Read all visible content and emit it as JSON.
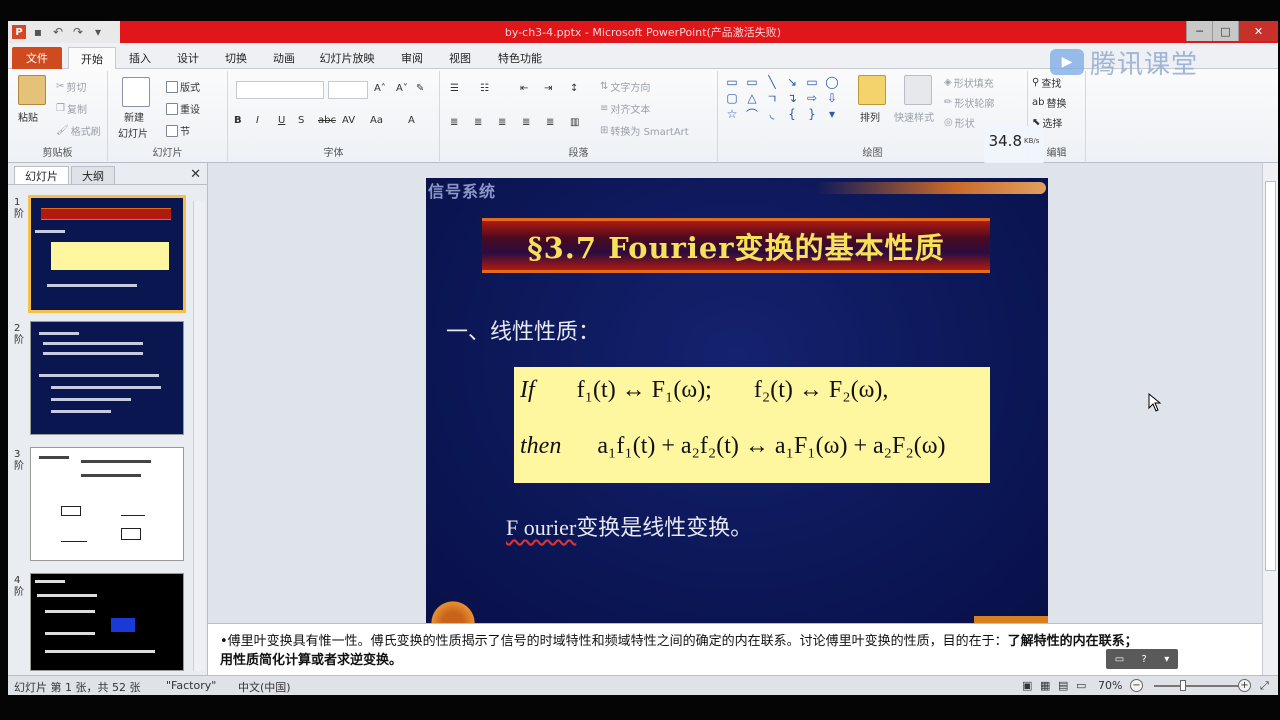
{
  "window": {
    "title": "by-ch3-4.pptx - Microsoft PowerPoint(产品激活失败)"
  },
  "ribbon_tabs": [
    {
      "label": "文件"
    },
    {
      "label": "开始"
    },
    {
      "label": "插入"
    },
    {
      "label": "设计"
    },
    {
      "label": "切换"
    },
    {
      "label": "动画"
    },
    {
      "label": "幻灯片放映"
    },
    {
      "label": "审阅"
    },
    {
      "label": "视图"
    },
    {
      "label": "特色功能"
    }
  ],
  "ribbon": {
    "clipboard": {
      "paste": "粘贴",
      "cut": "剪切",
      "copy": "复制",
      "format_painter": "格式刷",
      "label": "剪贴板"
    },
    "slides": {
      "new_slide": "新建",
      "new_slide2": "幻灯片",
      "layout": "版式",
      "reset": "重设",
      "section": "节",
      "label": "幻灯片"
    },
    "font": {
      "label": "字体"
    },
    "paragraph": {
      "text_direction": "文字方向",
      "align_text": "对齐文本",
      "smartart": "转换为 SmartArt",
      "label": "段落"
    },
    "drawing": {
      "arrange": "排列",
      "quick_styles": "快速样式",
      "shape_fill": "形状填充",
      "shape_outline": "形状轮廓",
      "shape_effects": "形状",
      "label": "绘图"
    },
    "editing": {
      "find": "查找",
      "replace": "替换",
      "select": "选择",
      "label": "编辑"
    }
  },
  "overlay": {
    "brand": "腾讯课堂",
    "speed_value": "34.8",
    "speed_unit": "KB/s"
  },
  "left_pane": {
    "tabs": [
      "幻灯片",
      "大纲"
    ],
    "slides": [
      {
        "num": "1",
        "mark": "阶"
      },
      {
        "num": "2",
        "mark": "阶"
      },
      {
        "num": "3",
        "mark": "阶"
      },
      {
        "num": "4",
        "mark": "阶"
      }
    ]
  },
  "slide": {
    "header": "信号系统",
    "title": "§3.7 Fourier变换的基本性质",
    "section": "一、线性性质：",
    "formula": {
      "line1": [
        "If",
        "f₁(t) ↔ F₁(ω);",
        "f₂(t) ↔ F₂(ω),"
      ],
      "line2": [
        "then",
        "a₁f₁(t) + a₂f₂(t) ↔ a₁F₁(ω) + a₂F₂(ω)"
      ]
    },
    "note_word": "F ourier",
    "note_rest": "变换是线性变换。"
  },
  "notes": {
    "text": "•傅里叶变换具有惟一性。傅氏变换的性质揭示了信号的时域特性和频域特性之间的确定的内在联系。讨论傅里叶变换的性质，目的在于：",
    "bold_tail": "了解特性的内在联系；",
    "line3": "用性质简化计算或者求逆变换。"
  },
  "statusbar": {
    "slide_info": "幻灯片 第 1 张，共 52 张",
    "theme": "\"Factory\"",
    "language": "中文(中国)",
    "zoom": "70%"
  }
}
